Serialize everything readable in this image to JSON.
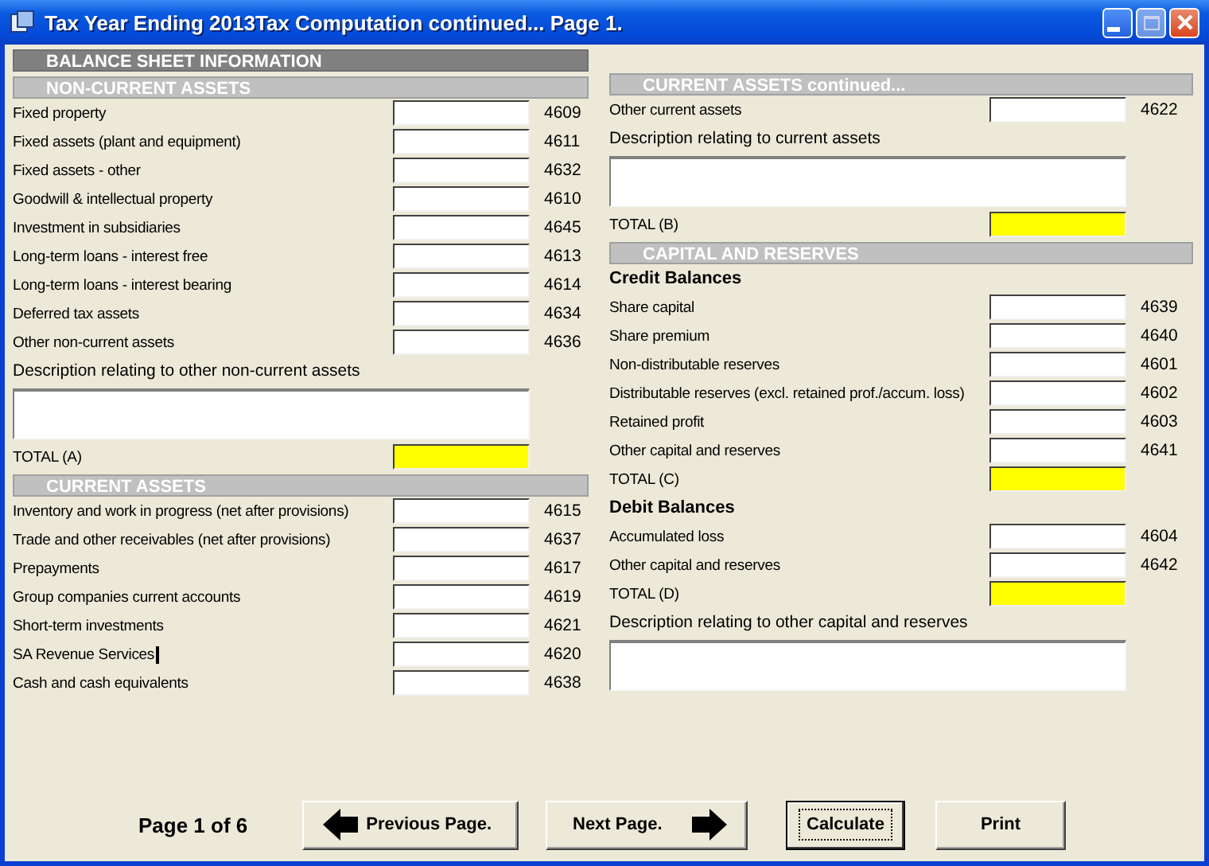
{
  "window": {
    "title": "Tax Year Ending 2013Tax Computation continued...  Page 1."
  },
  "panels": [
    {
      "items": [
        {
          "kind": "title",
          "text": "BALANCE SHEET INFORMATION"
        },
        {
          "kind": "header",
          "text": "NON-CURRENT ASSETS"
        },
        {
          "kind": "field",
          "label": "Fixed property",
          "code": "4609"
        },
        {
          "kind": "field",
          "label": "Fixed assets (plant and equipment)",
          "code": "4611"
        },
        {
          "kind": "field",
          "label": "Fixed assets - other",
          "code": "4632"
        },
        {
          "kind": "field",
          "label": "Goodwill & intellectual property",
          "code": "4610"
        },
        {
          "kind": "field",
          "label": "Investment in subsidiaries",
          "code": "4645"
        },
        {
          "kind": "field",
          "label": "Long-term loans - interest free",
          "code": "4613"
        },
        {
          "kind": "field",
          "label": "Long-term loans - interest bearing",
          "code": "4614"
        },
        {
          "kind": "field",
          "label": "Deferred tax assets",
          "code": "4634"
        },
        {
          "kind": "field",
          "label": "Other non-current assets",
          "code": "4636"
        },
        {
          "kind": "label",
          "text": "Description relating to other non-current assets"
        },
        {
          "kind": "textarea"
        },
        {
          "kind": "total",
          "label": "TOTAL (A)"
        },
        {
          "kind": "header",
          "text": "CURRENT ASSETS"
        },
        {
          "kind": "field",
          "label": "Inventory and work in progress (net after provisions)",
          "code": "4615"
        },
        {
          "kind": "field",
          "label": "Trade and other receivables (net after provisions)",
          "code": "4637"
        },
        {
          "kind": "field",
          "label": "Prepayments",
          "code": "4617"
        },
        {
          "kind": "field",
          "label": "Group companies current accounts",
          "code": "4619"
        },
        {
          "kind": "field",
          "label": "Short-term investments",
          "code": "4621"
        },
        {
          "kind": "field",
          "label": "SA Revenue Services",
          "code": "4620",
          "caret": true
        },
        {
          "kind": "field",
          "label": "Cash and cash equivalents",
          "code": "4638"
        }
      ]
    },
    {
      "items": [
        {
          "kind": "header",
          "text": "CURRENT ASSETS continued..."
        },
        {
          "kind": "field",
          "label": "Other current assets",
          "code": "4622"
        },
        {
          "kind": "label",
          "text": "Description relating to current assets"
        },
        {
          "kind": "textarea"
        },
        {
          "kind": "total",
          "label": "TOTAL (B)"
        },
        {
          "kind": "header",
          "text": "CAPITAL AND RESERVES"
        },
        {
          "kind": "subheading",
          "text": "Credit Balances"
        },
        {
          "kind": "field",
          "label": "Share capital",
          "code": "4639"
        },
        {
          "kind": "field",
          "label": "Share premium",
          "code": "4640"
        },
        {
          "kind": "field",
          "label": "Non-distributable reserves",
          "code": "4601"
        },
        {
          "kind": "field",
          "label": "Distributable reserves (excl. retained prof./accum. loss)",
          "code": "4602"
        },
        {
          "kind": "field",
          "label": "Retained profit",
          "code": "4603"
        },
        {
          "kind": "field",
          "label": "Other capital and reserves",
          "code": "4641"
        },
        {
          "kind": "total",
          "label": "TOTAL (C)"
        },
        {
          "kind": "subheading",
          "text": "Debit Balances"
        },
        {
          "kind": "field",
          "label": "Accumulated loss",
          "code": "4604"
        },
        {
          "kind": "field",
          "label": "Other capital and reserves",
          "code": "4642"
        },
        {
          "kind": "total",
          "label": "TOTAL (D)"
        },
        {
          "kind": "label",
          "text": "Description relating to other capital and reserves"
        },
        {
          "kind": "textarea"
        }
      ]
    }
  ],
  "footer": {
    "page": "Page 1 of 6",
    "buttons": [
      {
        "label": "Previous Page.",
        "kind": "back",
        "focused": false
      },
      {
        "label": "Next Page.",
        "kind": "forward",
        "focused": false
      },
      {
        "label": "Calculate",
        "kind": "plain",
        "focused": true
      },
      {
        "label": "Print",
        "kind": "plain",
        "focused": false
      }
    ]
  }
}
